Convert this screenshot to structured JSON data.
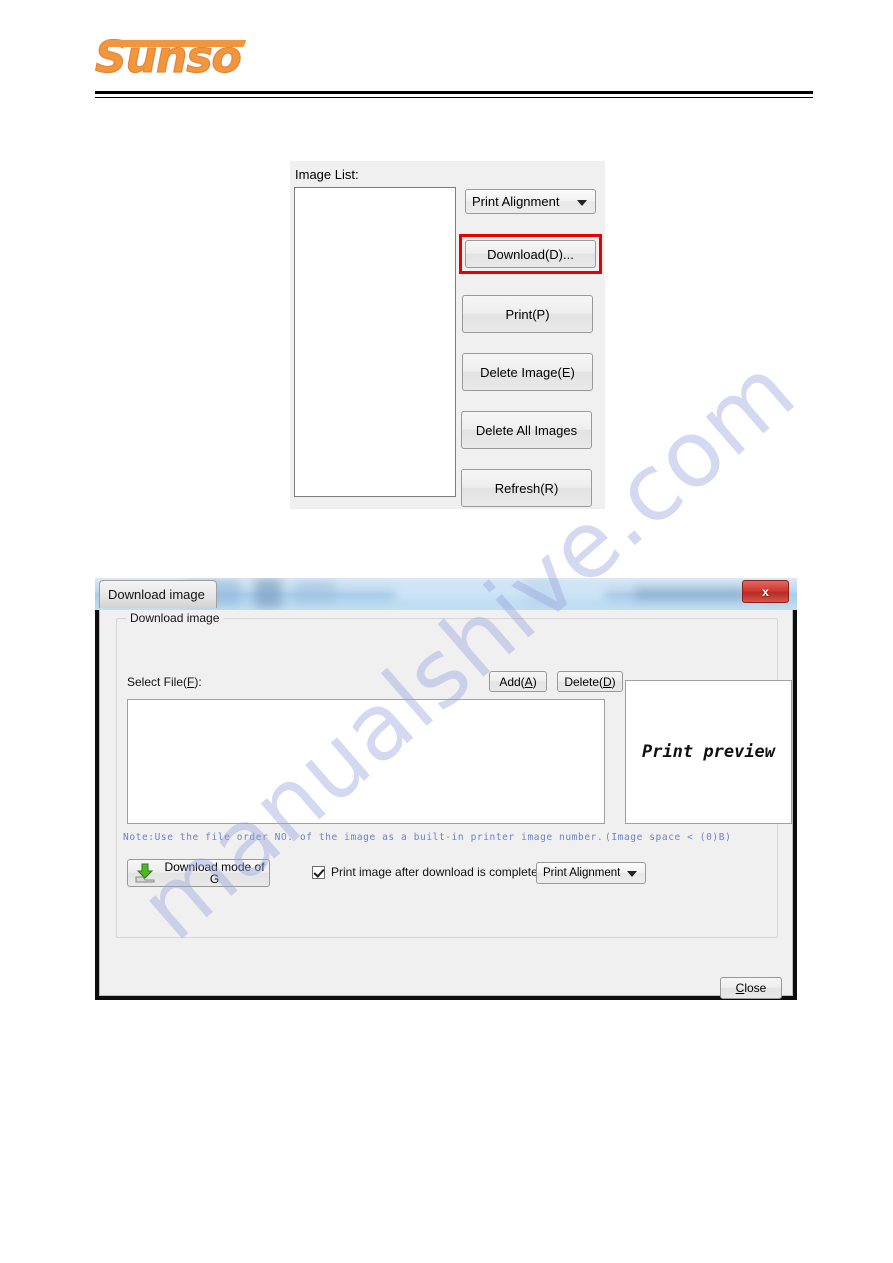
{
  "header": {
    "logo_text": "Sunso"
  },
  "watermark": {
    "text": "manualshive.com"
  },
  "image_list_panel": {
    "title": "Image List:",
    "listbox_value": "",
    "combo_print_alignment": "Print Alignment",
    "buttons": [
      {
        "id": "download",
        "label": "Download(D)...",
        "highlighted": true
      },
      {
        "id": "print",
        "label": "Print(P)",
        "highlighted": false
      },
      {
        "id": "delete_image",
        "label": "Delete Image(E)",
        "highlighted": false
      },
      {
        "id": "delete_all",
        "label": "Delete All Images",
        "highlighted": false
      },
      {
        "id": "refresh",
        "label": "Refresh(R)",
        "highlighted": false
      }
    ],
    "highlight_color": "#e80000"
  },
  "download_window": {
    "title": "Download image",
    "close_glyph": "x",
    "group_label": "Download image",
    "select_file_label": "Select File(F):",
    "add_button": "Add(A)",
    "delete_button": "Delete(D)",
    "file_listbox_value": "",
    "print_preview_text": "Print preview",
    "note_text": "Note:Use the file order NO. of the image as a built-in printer image number.",
    "image_space_text": "(Image space < (0)B)",
    "note_color": "#6e82c8",
    "download_mode_button": "Download mode of G",
    "print_after_checkbox_label": "Print image after download is completed",
    "print_after_checked": true,
    "combo_print_alignment": "Print Alignment",
    "close_button": "Close"
  }
}
